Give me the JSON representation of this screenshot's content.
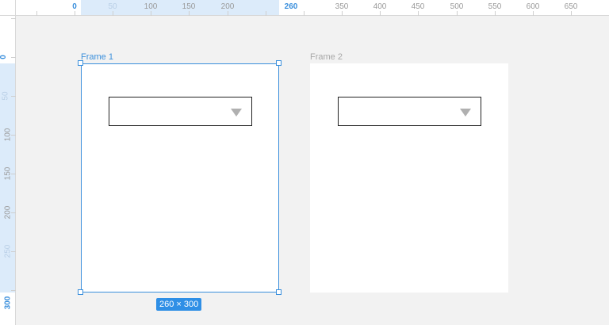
{
  "ruler_top": {
    "labels": [
      {
        "text": "0",
        "style": "edge",
        "value": 0
      },
      {
        "text": "50",
        "style": "dim",
        "value": 50
      },
      {
        "text": "100",
        "style": "normal",
        "value": 100
      },
      {
        "text": "150",
        "style": "normal",
        "value": 150
      },
      {
        "text": "200",
        "style": "normal",
        "value": 200
      },
      {
        "text": "260",
        "style": "edge",
        "value": 260
      },
      {
        "text": "350",
        "style": "normal",
        "value": 350
      },
      {
        "text": "400",
        "style": "normal",
        "value": 400
      },
      {
        "text": "450",
        "style": "normal",
        "value": 450
      },
      {
        "text": "500",
        "style": "normal",
        "value": 500
      },
      {
        "text": "550",
        "style": "normal",
        "value": 550
      },
      {
        "text": "600",
        "style": "normal",
        "value": 600
      },
      {
        "text": "650",
        "style": "normal",
        "value": 650
      }
    ]
  },
  "ruler_left": {
    "labels": [
      {
        "text": "0",
        "style": "edge",
        "value": 0
      },
      {
        "text": "50",
        "style": "dim",
        "value": 50
      },
      {
        "text": "100",
        "style": "normal",
        "value": 100
      },
      {
        "text": "150",
        "style": "normal",
        "value": 150
      },
      {
        "text": "200",
        "style": "normal",
        "value": 200
      },
      {
        "text": "250",
        "style": "dim",
        "value": 250
      },
      {
        "text": "300",
        "style": "edge",
        "value": 300
      }
    ]
  },
  "frames": {
    "frame1": {
      "title": "Frame 1",
      "selected": true
    },
    "frame2": {
      "title": "Frame 2",
      "selected": false
    }
  },
  "selection": {
    "size_label": "260 × 300"
  },
  "colors": {
    "accent": "#3a8fdc",
    "badge": "#2f8fe6",
    "canvas": "#f2f2f2",
    "dropdown_arrow": "#b0b0b0"
  },
  "icons": {
    "dropdown_arrow": "triangle-down-icon"
  }
}
